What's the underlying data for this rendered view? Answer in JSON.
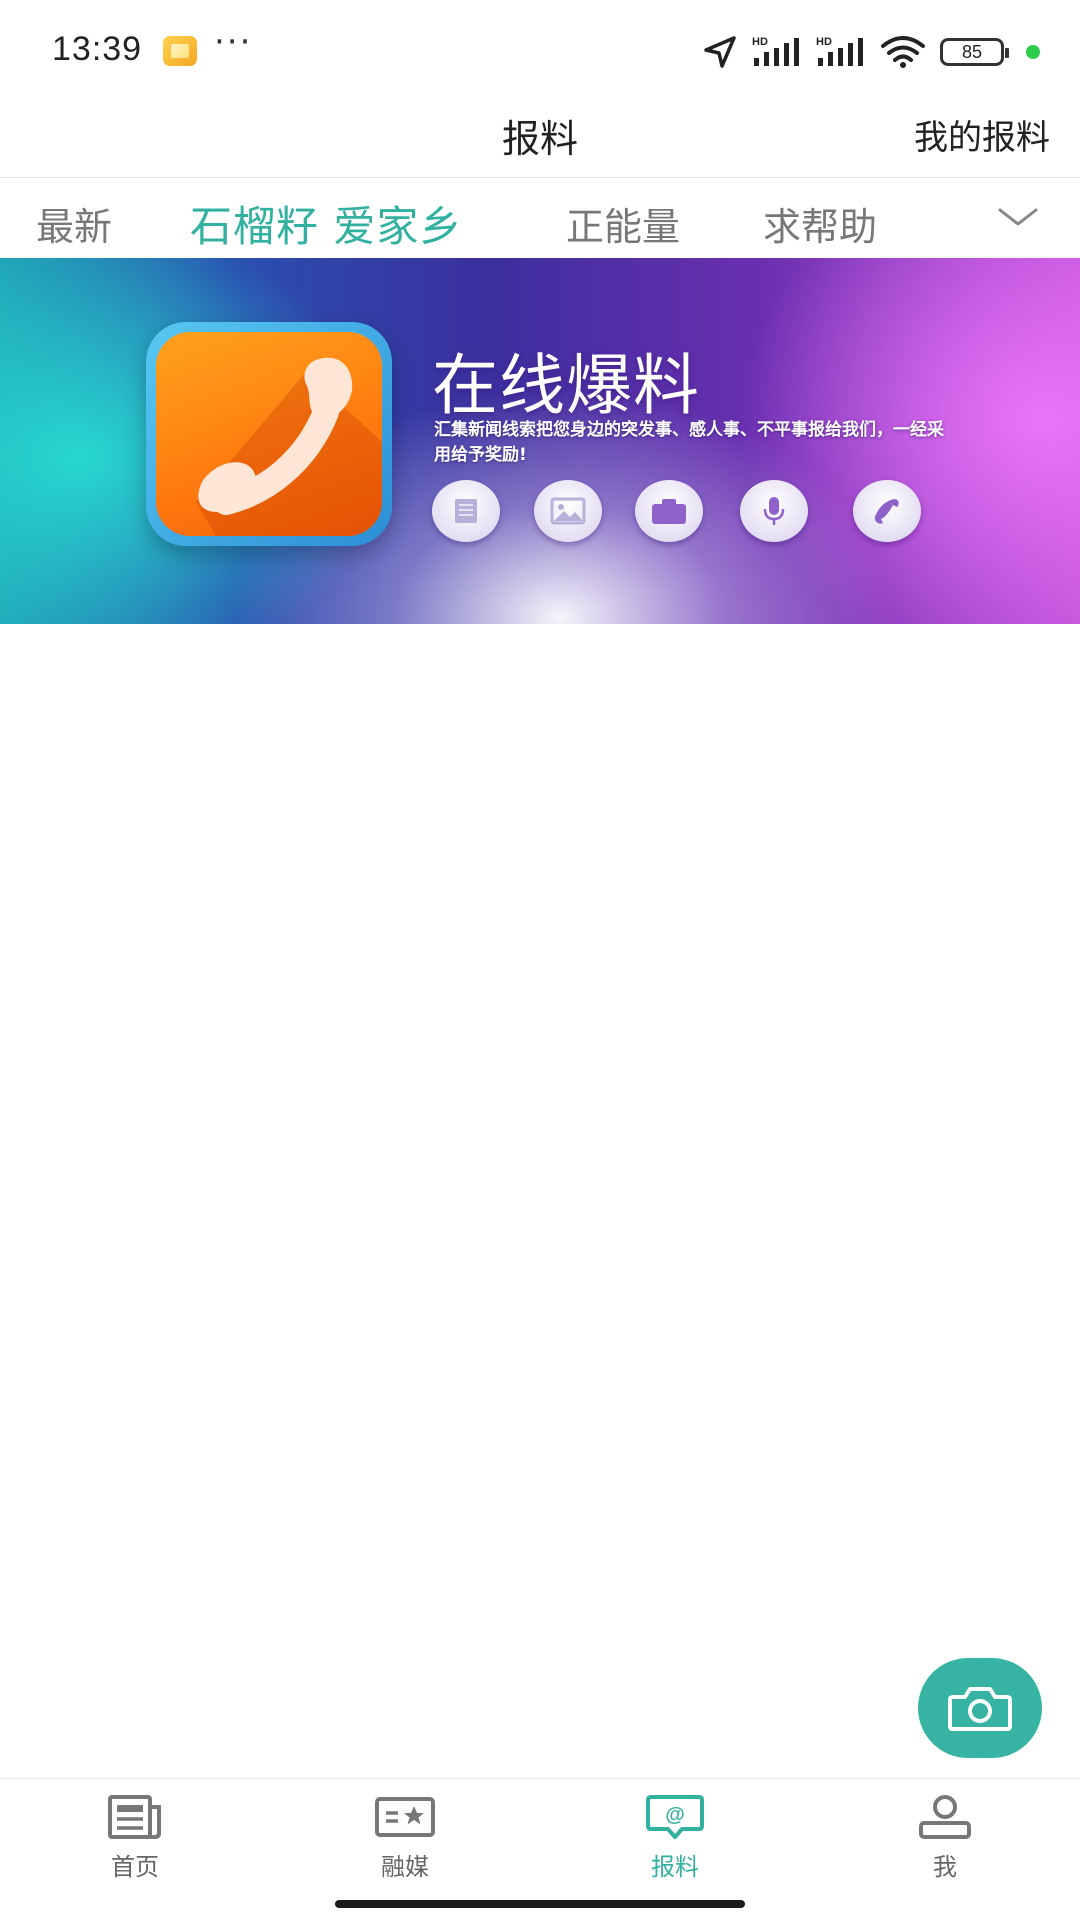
{
  "status_bar": {
    "time": "13:39",
    "more": "···",
    "battery": "85",
    "signal_labels": [
      "HD",
      "HD"
    ]
  },
  "header": {
    "title": "报料",
    "my_reports": "我的报料"
  },
  "tabs": [
    {
      "label": "最新",
      "active": false
    },
    {
      "label": "石榴籽 爱家乡",
      "active": true
    },
    {
      "label": "正能量",
      "active": false
    },
    {
      "label": "求帮助",
      "active": false
    }
  ],
  "banner": {
    "title": "在线爆料",
    "description": "汇集新闻线索把您身边的突发事、感人事、不平事报给我们，一经采用给予奖励!",
    "buttons": [
      "text-icon",
      "image-icon",
      "video-camera-icon",
      "microphone-icon",
      "phone-icon"
    ]
  },
  "fab": {
    "icon": "camera-icon"
  },
  "bottom_nav": [
    {
      "label": "首页",
      "icon": "news-icon",
      "active": false
    },
    {
      "label": "融媒",
      "icon": "media-card-icon",
      "active": false
    },
    {
      "label": "报料",
      "icon": "report-chat-icon",
      "active": true
    },
    {
      "label": "我",
      "icon": "user-icon",
      "active": false
    }
  ],
  "colors": {
    "accent": "#33b1a0",
    "fab": "#36b3a2",
    "inactive_text": "#777777",
    "battery_dot": "#2ecc4a"
  }
}
